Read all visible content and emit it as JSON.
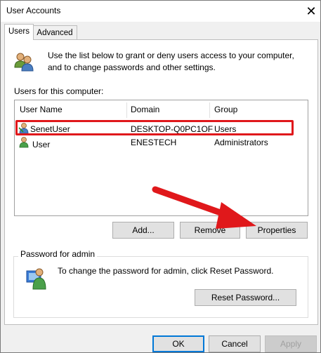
{
  "window": {
    "title": "User Accounts",
    "close_glyph": "✕"
  },
  "tabs": [
    {
      "label": "Users",
      "active": true
    },
    {
      "label": "Advanced",
      "active": false
    }
  ],
  "users_tab": {
    "intro_line1": "Use the list below to grant or deny users access to your computer,",
    "intro_line2": "and to change passwords and other settings.",
    "list_label": "Users for this computer:",
    "columns": [
      "User Name",
      "Domain",
      "Group"
    ],
    "rows": [
      {
        "user_name": "SenetUser",
        "domain": "DESKTOP-Q0PC1OF",
        "group": "Users"
      },
      {
        "user_name": "User",
        "domain": "ENESTECH",
        "group": "Administrators"
      }
    ],
    "buttons": {
      "add": "Add...",
      "remove": "Remove",
      "properties": "Properties"
    },
    "password_group": {
      "title": "Password for admin",
      "text": "To change the password for admin, click Reset Password.",
      "reset_button": "Reset Password..."
    }
  },
  "footer": {
    "ok": "OK",
    "cancel": "Cancel",
    "apply": "Apply"
  },
  "colors": {
    "highlight": "#e0181b",
    "arrow": "#e0181b",
    "accent": "#0078d7"
  }
}
